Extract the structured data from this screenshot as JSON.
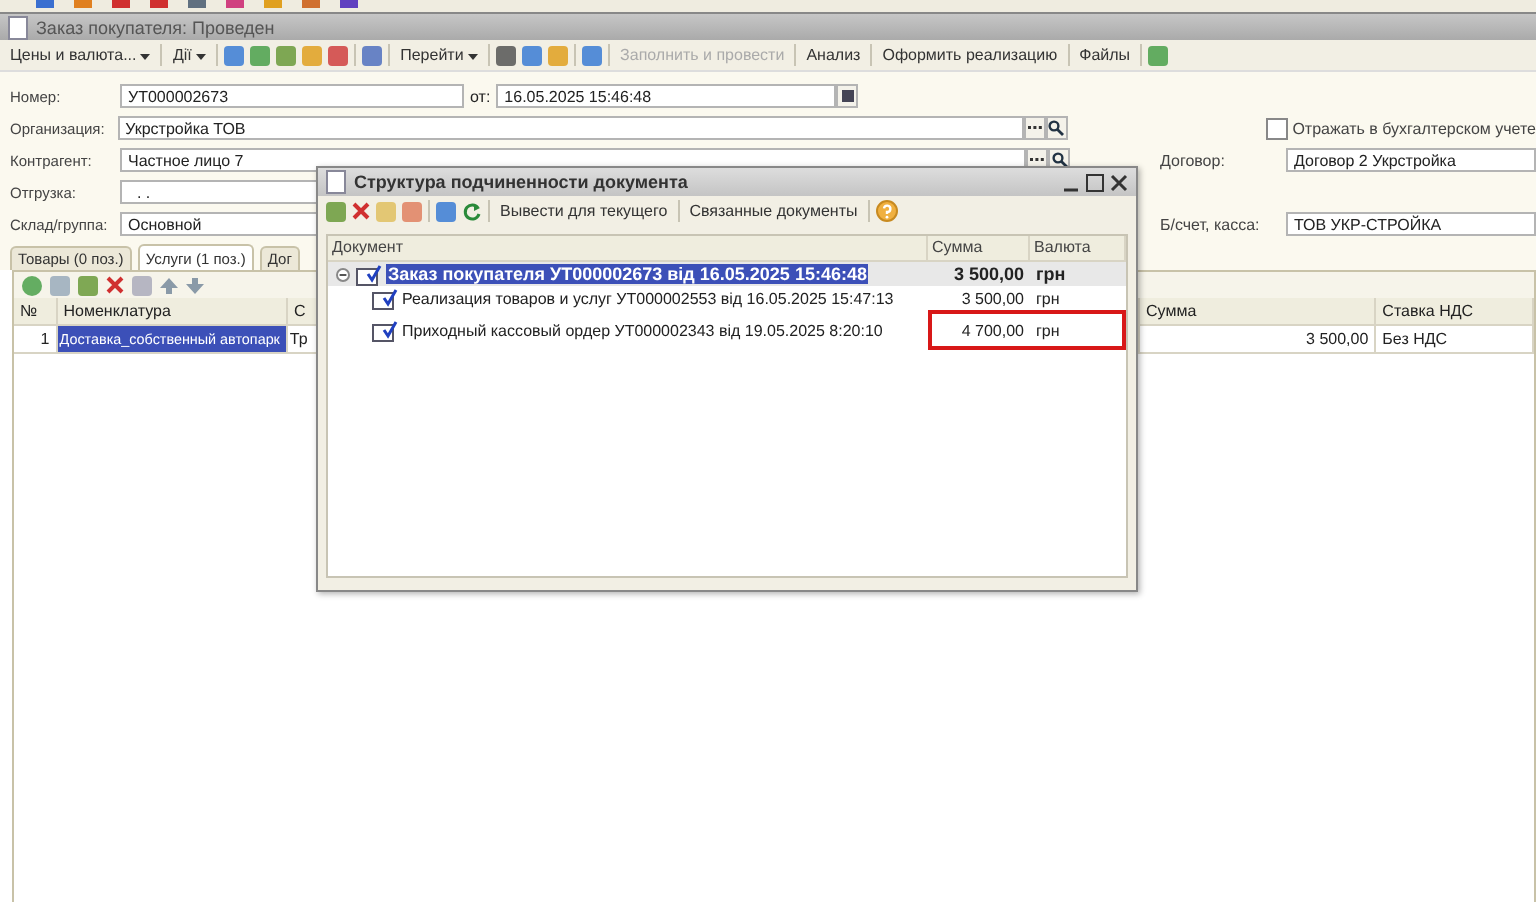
{
  "window": {
    "title": "Заказ покупателя: Проведен"
  },
  "toolbar": [
    {
      "kind": "menu",
      "label": "Цены и валюта..."
    },
    {
      "kind": "separator"
    },
    {
      "kind": "menu",
      "label": "Дії"
    },
    {
      "kind": "separator"
    },
    {
      "kind": "icon"
    },
    {
      "kind": "icon"
    },
    {
      "kind": "icon"
    },
    {
      "kind": "icon"
    },
    {
      "kind": "icon"
    },
    {
      "kind": "separator"
    },
    {
      "kind": "icon"
    },
    {
      "kind": "separator"
    },
    {
      "kind": "menu",
      "label": "Перейти"
    },
    {
      "kind": "separator"
    },
    {
      "kind": "icon"
    },
    {
      "kind": "icon"
    },
    {
      "kind": "icon"
    },
    {
      "kind": "separator"
    },
    {
      "kind": "icon"
    },
    {
      "kind": "separator"
    },
    {
      "kind": "button",
      "label": "Заполнить и провести",
      "disabled": true
    },
    {
      "kind": "separator"
    },
    {
      "kind": "button",
      "label": "Анализ",
      "disabled": false
    },
    {
      "kind": "separator"
    },
    {
      "kind": "button",
      "label": "Оформить реализацию",
      "disabled": false
    },
    {
      "kind": "separator"
    },
    {
      "kind": "button",
      "label": "Файлы",
      "disabled": false
    },
    {
      "kind": "separator"
    },
    {
      "kind": "icon"
    }
  ],
  "form": {
    "number": {
      "label": "Номер:",
      "value": "УТ000002673"
    },
    "date": {
      "label": "от:",
      "value": "16.05.2025 15:46:48"
    },
    "organization": {
      "label": "Организация:",
      "value": "Укрстройка ТОВ"
    },
    "counterparty": {
      "label": "Контрагент:",
      "value": "Частное лицо 7"
    },
    "shipment": {
      "label": "Отгрузка:",
      "value": ". ."
    },
    "warehouse": {
      "label": "Склад/группа:",
      "value": "Основной"
    },
    "accounting": {
      "label": "Отражать в бухгалтерском учете",
      "checked": false
    },
    "contract": {
      "label": "Договор:",
      "value": "Договор 2 Укрстройка"
    },
    "account": {
      "label": "Б/счет, касса:",
      "value": "ТОВ УКР-СТРОЙКА"
    }
  },
  "tabs": [
    {
      "label": "Товары (0 поз.)",
      "selected": false
    },
    {
      "label": "Услуги (1 поз.)",
      "selected": true
    },
    {
      "label": "Дог",
      "selected": false
    }
  ],
  "table": {
    "columns": [
      "№",
      "Номенклатура",
      "С",
      "Сумма",
      "Ставка НДС"
    ],
    "rows": [
      {
        "cells": [
          "1",
          "Доставка_собственный автопарк",
          "Тр",
          "3 500,00",
          "Без НДС"
        ],
        "selected": true
      }
    ]
  },
  "dialog": {
    "title": "Структура подчиненности документа",
    "buttons": [
      "Вывести для текущего",
      "Связанные документы"
    ],
    "columns": [
      "Документ",
      "Сумма",
      "Валюта"
    ],
    "tree": [
      {
        "name": "Заказ покупателя УТ000002673 від 16.05.2025 15:46:48",
        "sum": "3 500,00",
        "currency": "грн",
        "selected": true,
        "expanded": true,
        "highlighted": false,
        "children": [
          {
            "name": "Реализация товаров и услуг УТ000002553 від 16.05.2025 15:47:13",
            "sum": "3 500,00",
            "currency": "грн",
            "selected": false,
            "highlighted": false
          },
          {
            "name": "Приходный кассовый ордер УТ000002343 від 19.05.2025 8:20:10",
            "sum": "4 700,00",
            "currency": "грн",
            "selected": false,
            "highlighted": true
          }
        ]
      }
    ]
  }
}
